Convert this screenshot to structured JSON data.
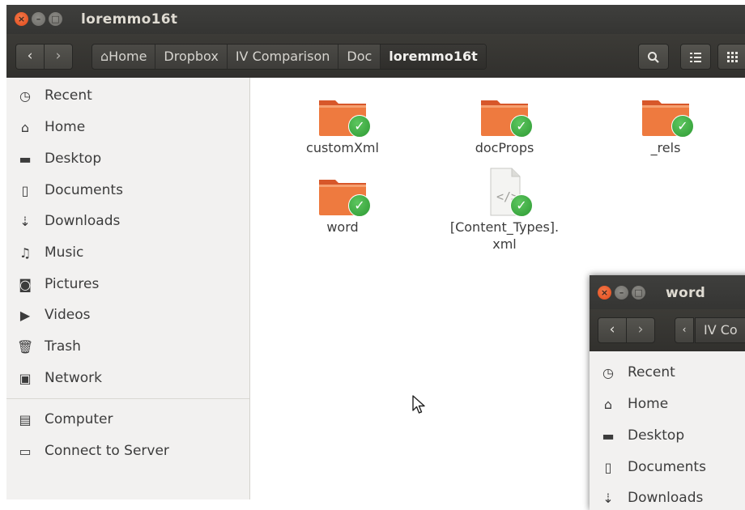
{
  "window": {
    "title": "loremmo16t",
    "breadcrumbs": [
      {
        "icon": "home-icon",
        "label": "Home"
      },
      {
        "label": "Dropbox"
      },
      {
        "label": "IV Comparison"
      },
      {
        "label": "Doc"
      },
      {
        "label": "loremmo16t",
        "active": true
      }
    ],
    "toolbar": {
      "search_icon": "search-icon",
      "list_icon": "list-view-icon",
      "grid_icon": "grid-view-icon"
    }
  },
  "sidebar": {
    "items": [
      {
        "icon": "recent-icon",
        "label": "Recent"
      },
      {
        "icon": "home-icon",
        "label": "Home"
      },
      {
        "icon": "desktop-icon",
        "label": "Desktop"
      },
      {
        "icon": "documents-icon",
        "label": "Documents"
      },
      {
        "icon": "downloads-icon",
        "label": "Downloads"
      },
      {
        "icon": "music-icon",
        "label": "Music"
      },
      {
        "icon": "pictures-icon",
        "label": "Pictures"
      },
      {
        "icon": "videos-icon",
        "label": "Videos"
      },
      {
        "icon": "trash-icon",
        "label": "Trash"
      },
      {
        "icon": "network-icon",
        "label": "Network"
      }
    ],
    "devices": [
      {
        "icon": "computer-icon",
        "label": "Computer"
      },
      {
        "icon": "server-icon",
        "label": "Connect to Server"
      }
    ]
  },
  "files": [
    {
      "name": "customXml",
      "type": "folder",
      "synced": true
    },
    {
      "name": "docProps",
      "type": "folder",
      "synced": true
    },
    {
      "name": "_rels",
      "type": "folder",
      "synced": true
    },
    {
      "name": "word",
      "type": "folder",
      "synced": true
    },
    {
      "name_line1": "[Content_Types].",
      "name_line2": "xml",
      "type": "xml-file",
      "synced": true
    }
  ],
  "second_window": {
    "title": "word",
    "breadcrumb_partial": "IV Co",
    "sidebar_items": [
      {
        "icon": "recent-icon",
        "label": "Recent"
      },
      {
        "icon": "home-icon",
        "label": "Home"
      },
      {
        "icon": "desktop-icon",
        "label": "Desktop"
      },
      {
        "icon": "documents-icon",
        "label": "Documents"
      },
      {
        "icon": "downloads-icon",
        "label": "Downloads"
      }
    ]
  },
  "colors": {
    "titlebar": "#3c3b37",
    "close_button": "#e9541f",
    "folder_orange": "#e9692c",
    "sync_check": "#3daf3f"
  }
}
